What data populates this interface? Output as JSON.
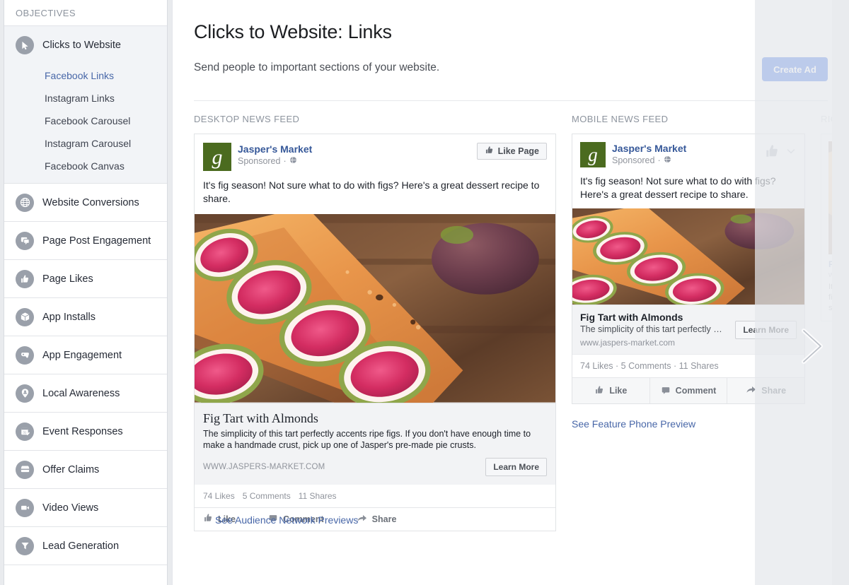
{
  "sidebar": {
    "header": "OBJECTIVES",
    "active_objective": {
      "label": "Clicks to Website",
      "icon": "cursor-icon",
      "sub_items": [
        {
          "label": "Facebook Links",
          "selected": true
        },
        {
          "label": "Instagram Links",
          "selected": false
        },
        {
          "label": "Facebook Carousel",
          "selected": false
        },
        {
          "label": "Instagram Carousel",
          "selected": false
        },
        {
          "label": "Facebook Canvas",
          "selected": false
        }
      ]
    },
    "items": [
      {
        "label": "Website Conversions",
        "icon": "globe-icon"
      },
      {
        "label": "Page Post Engagement",
        "icon": "chat-bubbles-icon"
      },
      {
        "label": "Page Likes",
        "icon": "thumbs-up-icon"
      },
      {
        "label": "App Installs",
        "icon": "box-icon"
      },
      {
        "label": "App Engagement",
        "icon": "gamepad-icon"
      },
      {
        "label": "Local Awareness",
        "icon": "map-pin-person-icon"
      },
      {
        "label": "Event Responses",
        "icon": "calendar-check-icon"
      },
      {
        "label": "Offer Claims",
        "icon": "ticket-icon"
      },
      {
        "label": "Video Views",
        "icon": "video-camera-icon"
      },
      {
        "label": "Lead Generation",
        "icon": "funnel-icon"
      }
    ]
  },
  "header": {
    "title": "Clicks to Website: Links",
    "subtitle": "Send people to important sections of your website.",
    "create_ad_label": "Create Ad",
    "accent_color": "#5280e8"
  },
  "previews": {
    "desktop_heading": "DESKTOP NEWS FEED",
    "mobile_heading": "MOBILE NEWS FEED",
    "right_heading": "RIGHT COLUMN"
  },
  "ad": {
    "page_name": "Jasper's Market",
    "sponsored_label": "Sponsored",
    "privacy_icon": "globe-icon",
    "logo_letter": "g",
    "logo_color": "#4b6b1f",
    "body_text": "It's fig season! Not sure what to do with figs? Here's a great dessert recipe to share.",
    "like_page_label": "Like Page",
    "link_title": "Fig Tart with Almonds",
    "link_description": "The simplicity of this tart perfectly accents ripe figs. If you don't have enough time to make a handmade crust, pick up one of Jasper's pre-made pie crusts.",
    "link_description_short": "The simplicity of this tart perfectly …",
    "link_url_desktop": "WWW.JASPERS-MARKET.COM",
    "link_url_mobile": "www.jaspers-market.com",
    "cta_label": "Learn More",
    "stats_desktop": {
      "likes": "74 Likes",
      "comments": "5 Comments",
      "shares": "11 Shares"
    },
    "stats_mobile": "74 Likes · 5 Comments · 11 Shares",
    "actions": [
      {
        "label": "Like",
        "icon": "thumbs-up-icon"
      },
      {
        "label": "Comment",
        "icon": "comment-icon"
      },
      {
        "label": "Share",
        "icon": "share-arrow-icon"
      }
    ]
  },
  "links": {
    "feature_phone": "See Feature Phone Preview",
    "audience_network": "See Audience Network Previews"
  }
}
